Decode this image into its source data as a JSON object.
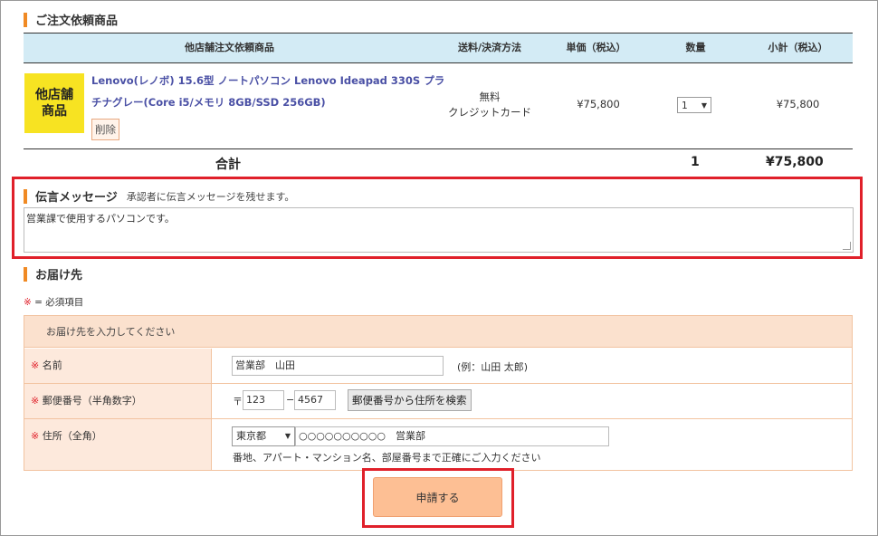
{
  "order_section": {
    "title": "ご注文依頼商品",
    "columns": [
      "他店舗注文依頼商品",
      "送料/決済方法",
      "単価（税込）",
      "数量",
      "小計（税込）"
    ],
    "item": {
      "badge_line1": "他店舗",
      "badge_line2": "商品",
      "name_line1": "Lenovo(レノボ) 15.6型 ノートパソコン Lenovo Ideapad 330S プラ",
      "name_line2": "チナグレー(Core i5/メモリ 8GB/SSD 256GB)",
      "delete_label": "削除",
      "shipping": "無料",
      "payment": "クレジットカード",
      "unit_price": "¥75,800",
      "quantity": "1",
      "subtotal": "¥75,800"
    },
    "total_label": "合計",
    "total_quantity": "1",
    "total_amount": "¥75,800"
  },
  "message_section": {
    "title": "伝言メッセージ",
    "note": "承認者に伝言メッセージを残せます。",
    "value": "営業課で使用するパソコンです。"
  },
  "delivery_section": {
    "title": "お届け先",
    "required_mark": "※",
    "required_note": "= 必須項目",
    "form_header": "お届け先を入力してください",
    "name_label": "名前",
    "name_value": "営業部　山田",
    "name_example": "(例：山田 太郎)",
    "zip_label": "郵便番号（半角数字）",
    "zip_mark": "〒",
    "zip1": "123",
    "zip_dash": "−",
    "zip2": "4567",
    "zip_search_button": "郵便番号から住所を検索",
    "address_label": "住所（全角）",
    "prefecture": "東京都",
    "address_value": "○○○○○○○○○○　営業部",
    "address_hint": "番地、アパート・マンション名、部屋番号まで正確にご入力ください"
  },
  "submit_label": "申請する",
  "colors": {
    "accent": "#f08a24",
    "required": "#e0202a",
    "header_bg": "#d3ebf5",
    "badge": "#f7e322",
    "product_link": "#4a50a5",
    "submit_bg": "#fdbf94"
  }
}
